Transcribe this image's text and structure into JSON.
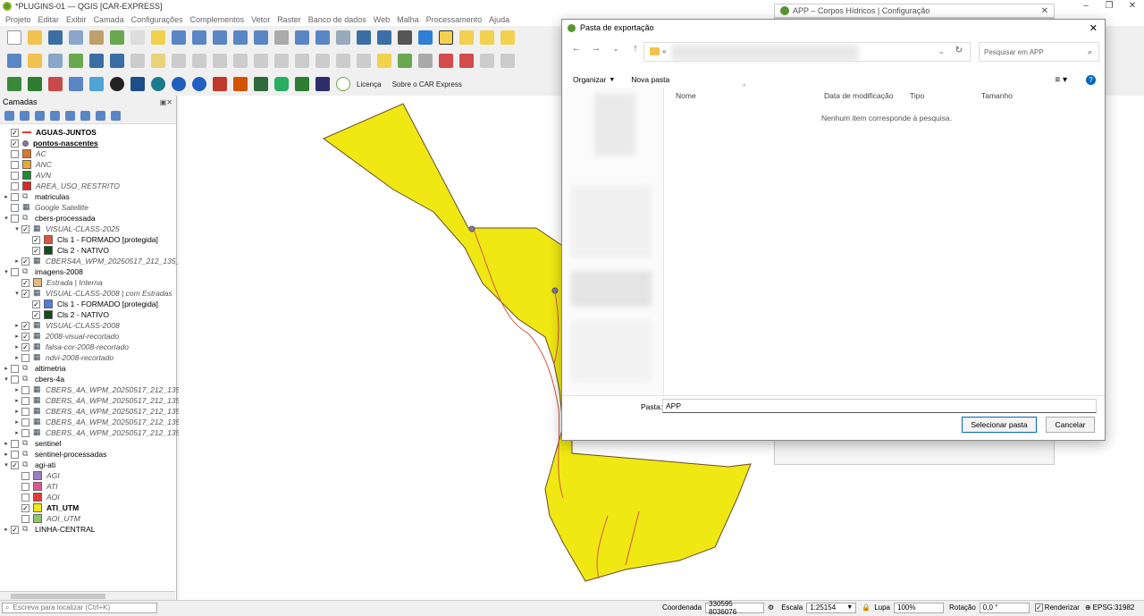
{
  "window": {
    "title": "*PLUGINS-01 — QGIS [CAR-EXPRESS]"
  },
  "menu": [
    "Projeto",
    "Editar",
    "Exibir",
    "Camada",
    "Configurações",
    "Complementos",
    "Vetor",
    "Raster",
    "Banco de dados",
    "Web",
    "Malha",
    "Processamento",
    "Ajuda"
  ],
  "plugin_toolbar": {
    "licenca": "Licença",
    "sobre": "Sobre o CAR Express"
  },
  "layers_panel": {
    "title": "Camadas",
    "layers": [
      {
        "label": "AGUAS-JUNTOS",
        "checked": true,
        "style": "bold",
        "indent": 0,
        "arrow": "",
        "symbol": "line",
        "color": "#e53935"
      },
      {
        "label": "pontos-nascentes",
        "checked": true,
        "style": "bold-underline",
        "indent": 0,
        "arrow": "",
        "symbol": "point",
        "color": "#8a6fb7"
      },
      {
        "label": "AC",
        "checked": false,
        "style": "italic",
        "indent": 0,
        "arrow": "",
        "symbol": "fill",
        "color": "#d97a2b"
      },
      {
        "label": "ANC",
        "checked": false,
        "style": "italic",
        "indent": 0,
        "arrow": "",
        "symbol": "fill",
        "color": "#f2a62a"
      },
      {
        "label": "AVN",
        "checked": false,
        "style": "italic",
        "indent": 0,
        "arrow": "",
        "symbol": "fill",
        "color": "#1f8a2f"
      },
      {
        "label": "AREA_USO_RESTRITO",
        "checked": false,
        "style": "italic",
        "indent": 0,
        "arrow": "",
        "symbol": "fill",
        "color": "#d62828"
      },
      {
        "label": "matriculas",
        "checked": false,
        "style": "normal",
        "indent": 0,
        "arrow": "▸",
        "symbol": "group",
        "color": ""
      },
      {
        "label": "Google Satellite",
        "checked": false,
        "style": "italic",
        "indent": 0,
        "arrow": "",
        "symbol": "raster",
        "color": ""
      },
      {
        "label": "cbers-processada",
        "checked": false,
        "style": "normal",
        "indent": 0,
        "arrow": "▾",
        "symbol": "group",
        "color": ""
      },
      {
        "label": "VISUAL-CLASS-2025",
        "checked": true,
        "style": "italic",
        "indent": 1,
        "arrow": "▾",
        "symbol": "raster",
        "color": ""
      },
      {
        "label": "Cls 1 - FORMADO [protegida]",
        "checked": true,
        "style": "normal",
        "indent": 2,
        "arrow": "",
        "symbol": "fill",
        "color": "#e0533d"
      },
      {
        "label": "Cls 2 - NATIVO",
        "checked": true,
        "style": "normal",
        "indent": 2,
        "arrow": "",
        "symbol": "fill",
        "color": "#0e4d1c"
      },
      {
        "label": "CBERS4A_WPM_20250517_212_135_l",
        "checked": true,
        "style": "italic",
        "indent": 1,
        "arrow": "▸",
        "symbol": "raster",
        "color": ""
      },
      {
        "label": "imagens-2008",
        "checked": false,
        "style": "normal",
        "indent": 0,
        "arrow": "▾",
        "symbol": "group",
        "color": ""
      },
      {
        "label": "Estrada | Interna",
        "checked": true,
        "style": "italic",
        "indent": 1,
        "arrow": "",
        "symbol": "fill",
        "color": "#e8b97a"
      },
      {
        "label": "VISUAL-CLASS-2008 | com Estradas",
        "checked": true,
        "style": "italic",
        "indent": 1,
        "arrow": "▾",
        "symbol": "raster",
        "color": ""
      },
      {
        "label": "Cls 1 - FORMADO [protegida]",
        "checked": true,
        "style": "normal",
        "indent": 2,
        "arrow": "",
        "symbol": "fill",
        "color": "#4a7fe0"
      },
      {
        "label": "Cls 2 - NATIVO",
        "checked": true,
        "style": "normal",
        "indent": 2,
        "arrow": "",
        "symbol": "fill",
        "color": "#0e4d1c"
      },
      {
        "label": "VISUAL-CLASS-2008",
        "checked": true,
        "style": "italic",
        "indent": 1,
        "arrow": "▸",
        "symbol": "raster",
        "color": ""
      },
      {
        "label": "2008-visual-recortado",
        "checked": true,
        "style": "italic",
        "indent": 1,
        "arrow": "▸",
        "symbol": "raster",
        "color": ""
      },
      {
        "label": "falsa-cor-2008-recortado",
        "checked": true,
        "style": "italic",
        "indent": 1,
        "arrow": "▸",
        "symbol": "raster",
        "color": ""
      },
      {
        "label": "ndvi-2008-recortado",
        "checked": false,
        "style": "italic",
        "indent": 1,
        "arrow": "▸",
        "symbol": "raster",
        "color": ""
      },
      {
        "label": "altimetria",
        "checked": false,
        "style": "normal",
        "indent": 0,
        "arrow": "▸",
        "symbol": "group",
        "color": ""
      },
      {
        "label": "cbers-4a",
        "checked": false,
        "style": "normal",
        "indent": 0,
        "arrow": "▾",
        "symbol": "group",
        "color": ""
      },
      {
        "label": "CBERS_4A_WPM_20250517_212_135_",
        "checked": false,
        "style": "italic",
        "indent": 1,
        "arrow": "▸",
        "symbol": "raster",
        "color": ""
      },
      {
        "label": "CBERS_4A_WPM_20250517_212_135_",
        "checked": false,
        "style": "italic",
        "indent": 1,
        "arrow": "▸",
        "symbol": "raster",
        "color": ""
      },
      {
        "label": "CBERS_4A_WPM_20250517_212_135_",
        "checked": false,
        "style": "italic",
        "indent": 1,
        "arrow": "▸",
        "symbol": "raster",
        "color": ""
      },
      {
        "label": "CBERS_4A_WPM_20250517_212_135_",
        "checked": false,
        "style": "italic",
        "indent": 1,
        "arrow": "▸",
        "symbol": "raster",
        "color": ""
      },
      {
        "label": "CBERS_4A_WPM_20250517_212_135_",
        "checked": false,
        "style": "italic",
        "indent": 1,
        "arrow": "▸",
        "symbol": "raster",
        "color": ""
      },
      {
        "label": "sentinel",
        "checked": false,
        "style": "normal",
        "indent": 0,
        "arrow": "▸",
        "symbol": "group",
        "color": ""
      },
      {
        "label": "sentinel-processadas",
        "checked": false,
        "style": "normal",
        "indent": 0,
        "arrow": "▸",
        "symbol": "group",
        "color": ""
      },
      {
        "label": "agi-ati",
        "checked": true,
        "style": "normal",
        "indent": 0,
        "arrow": "▾",
        "symbol": "group",
        "color": ""
      },
      {
        "label": "AGI",
        "checked": false,
        "style": "italic",
        "indent": 1,
        "arrow": "",
        "symbol": "fill",
        "color": "#9b7fc2"
      },
      {
        "label": "ATI",
        "checked": false,
        "style": "italic",
        "indent": 1,
        "arrow": "",
        "symbol": "fill",
        "color": "#e05590"
      },
      {
        "label": "AOI",
        "checked": false,
        "style": "italic",
        "indent": 1,
        "arrow": "",
        "symbol": "fill",
        "color": "#e03a3a"
      },
      {
        "label": "ATI_UTM",
        "checked": true,
        "style": "bold",
        "indent": 1,
        "arrow": "",
        "symbol": "fill",
        "color": "#efe813"
      },
      {
        "label": "AOI_UTM",
        "checked": false,
        "style": "italic",
        "indent": 1,
        "arrow": "",
        "symbol": "fill",
        "color": "#8dc96a"
      },
      {
        "label": "LINHA-CENTRAL",
        "checked": true,
        "style": "normal",
        "indent": 0,
        "arrow": "▸",
        "symbol": "group",
        "color": ""
      }
    ]
  },
  "background_window": {
    "title": "APP – Corpos Hídricos | Configuração"
  },
  "dialog": {
    "title": "Pasta de exportação",
    "search_placeholder": "Pesquisar em APP",
    "organize": "Organizar",
    "new_folder": "Nova pasta",
    "columns": [
      "Nome",
      "Data de modificação",
      "Tipo",
      "Tamanho"
    ],
    "empty_message": "Nenhum item corresponde à pesquisa.",
    "folder_label": "Pasta:",
    "folder_value": "APP",
    "select_button": "Selecionar pasta",
    "cancel_button": "Cancelar"
  },
  "statusbar": {
    "locator_placeholder": "Escreva para localizar (Ctrl+K)",
    "coord_label": "Coordenada",
    "coord_value": "330595 8036076",
    "scale_label": "Escala",
    "scale_value": "1:25154",
    "magnifier_label": "Lupa",
    "magnifier_value": "100%",
    "rotation_label": "Rotação",
    "rotation_value": "0,0 °",
    "render_label": "Renderizar",
    "crs": "EPSG:31982"
  },
  "colors": {
    "polygon_fill": "#efe813",
    "polygon_stroke": "#6b4a2a",
    "stream": "#d4583f",
    "accent": "#0067c0"
  }
}
